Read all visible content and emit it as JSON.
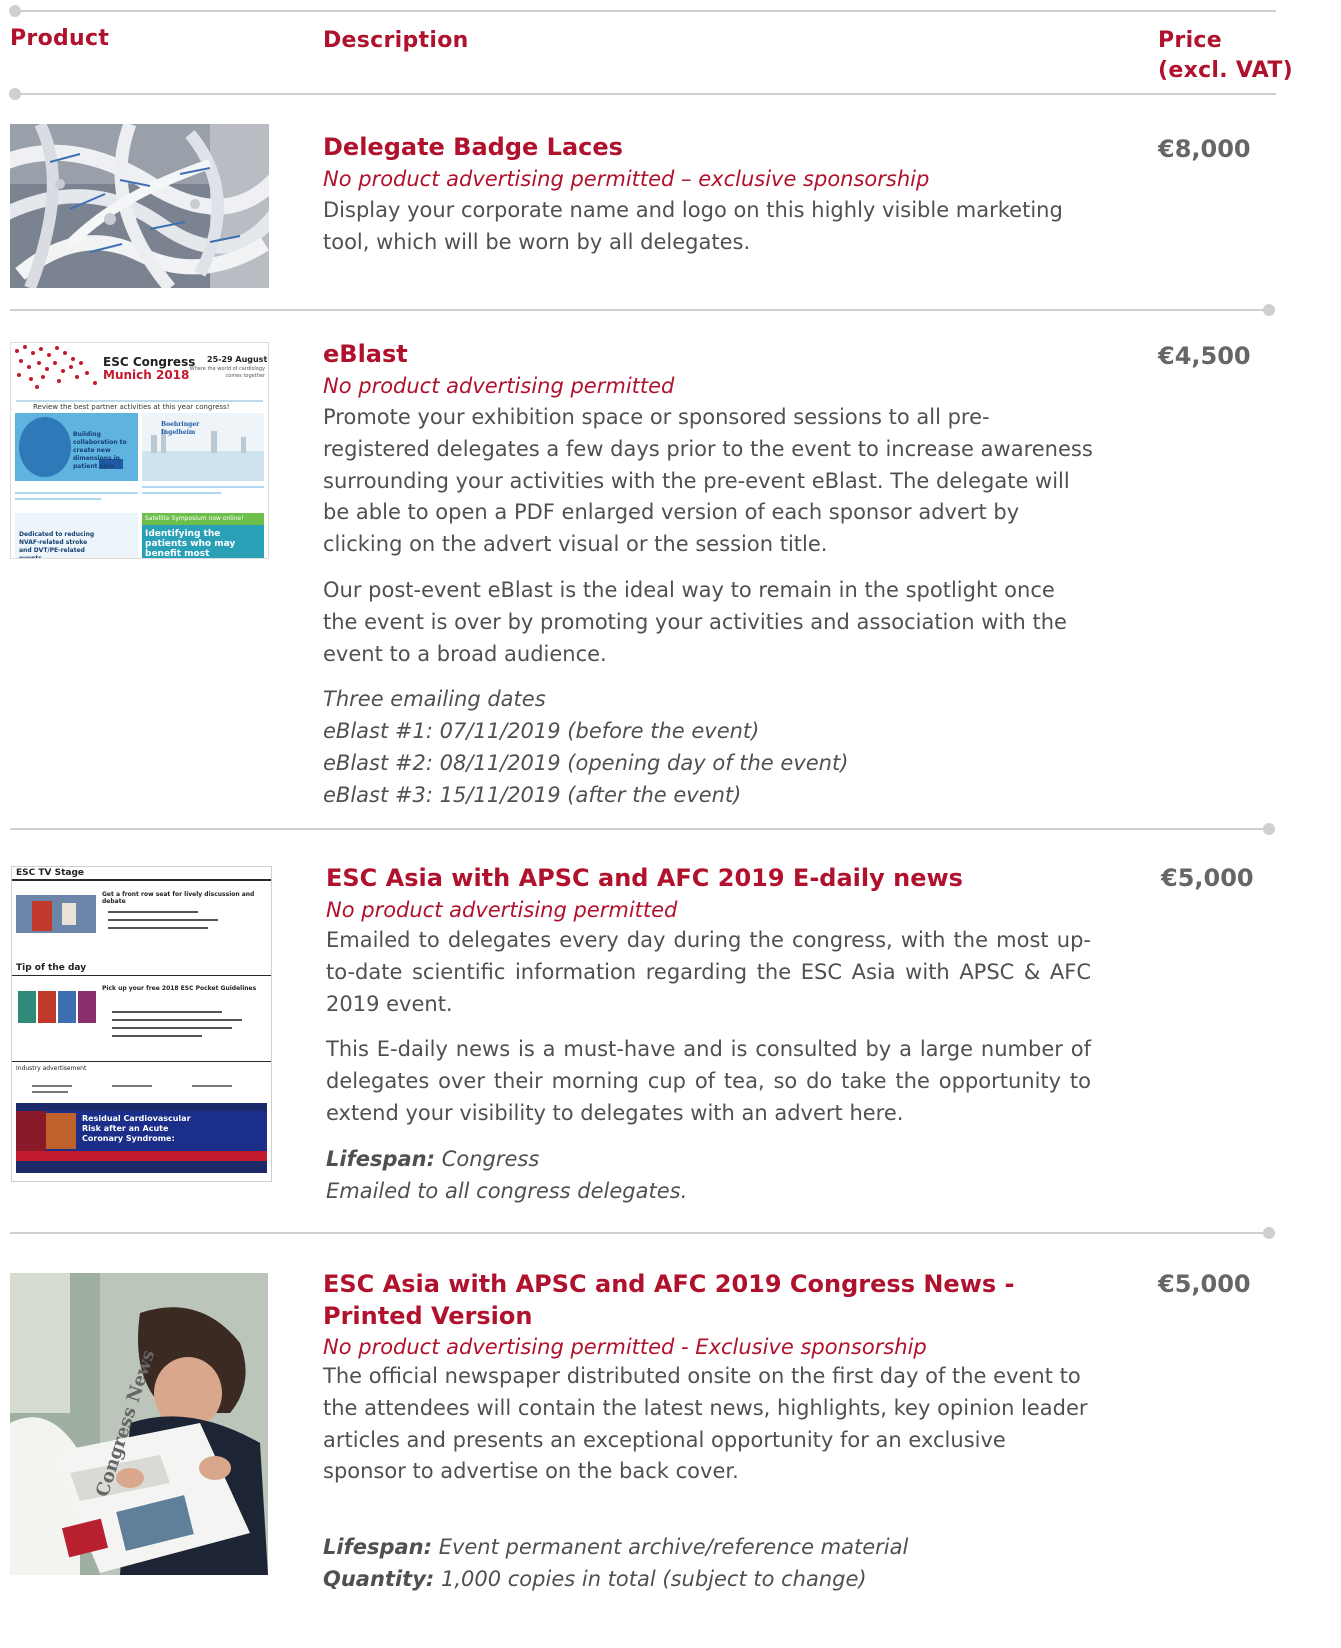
{
  "header": {
    "product": "Product",
    "description": "Description",
    "price_line1": "Price",
    "price_line2": "(excl. VAT)"
  },
  "items": [
    {
      "title": "Delegate Badge Laces",
      "subtitle": "No product advertising permitted – exclusive sponsorship",
      "body": "Display your corporate name and logo on this highly visible marketing tool, which will be worn by all delegates.",
      "price": "€8,000"
    },
    {
      "title": "eBlast",
      "subtitle": "No product advertising permitted",
      "body1": "Promote your exhibition space or sponsored sessions to all pre-registered delegates a few days prior to the event to increase awareness surrounding your activities with the pre-event eBlast. The delegate will be able to open a PDF enlarged version of each sponsor advert by clicking on the advert visual or the session title.",
      "body2": "Our post-event eBlast is the ideal way to remain in the spotlight once the event is over by promoting your activities and association with the event to a broad audience.",
      "dates_heading": "Three emailing dates",
      "dates": [
        "eBlast #1: 07/11/2019 (before the event)",
        "eBlast #2: 08/11/2019 (opening day of the event)",
        "eBlast #3: 15/11/2019 (after the event)"
      ],
      "price": "€4,500",
      "thumb": {
        "congress": "ESC Congress",
        "city": "Munich 2018",
        "dates": "25-29 August",
        "tagline": "Where the world of cardiology comes together",
        "banner": "Review the best partner activities at this year congress!",
        "card1": "Building collaboration to create new dimensions in patient care",
        "brand": "Boehringer Ingelheim",
        "card3": "Dedicated to reducing NVAF-related stroke and DVT/PE-related events",
        "card4a": "Satellite Symposium now online!",
        "card4b": "Identifying the patients who may benefit most"
      }
    },
    {
      "title": "ESC Asia with APSC and AFC 2019 E-daily news",
      "subtitle": "No product advertising permitted",
      "body1": "Emailed to delegates every day during the congress, with the most up-to-date scientific information regarding the ESC Asia with APSC & AFC 2019 event.",
      "body2": "This E-daily news is a must-have and is consulted by a large number of delegates over their morning cup of tea, so do take the opportunity to extend your visibility to delegates with an advert here.",
      "lifespan_label": "Lifespan:",
      "lifespan_value": " Congress",
      "note": "Emailed to all congress delegates.",
      "price": "€5,000",
      "thumb": {
        "stage": "ESC TV Stage",
        "headline": "Get a front row seat for lively discussion and debate",
        "tip": "Tip of the day",
        "tip_head": "Pick up your free 2018 ESC Pocket Guidelines",
        "industry": "Industry advertisement",
        "ad_title": "Residual Cardiovascular Risk after an Acute Coronary Syndrome:"
      }
    },
    {
      "title_line1": "ESC Asia with APSC and AFC 2019 Congress News -",
      "title_line2": "Printed Version",
      "subtitle": "No product advertising permitted - Exclusive sponsorship",
      "body": "The official newspaper distributed onsite on the first day of the event to the attendees will contain the latest news, highlights, key opinion leader articles and presents an exceptional opportunity for an exclusive sponsor to advertise on the back cover.",
      "lifespan_label": "Lifespan:",
      "lifespan_value": " Event permanent archive/reference material",
      "quantity_label": "Quantity:",
      "quantity_value": " 1,000 copies in total (subject to change)",
      "price": "€5,000",
      "thumb": {
        "paper": "Congress News"
      }
    }
  ]
}
